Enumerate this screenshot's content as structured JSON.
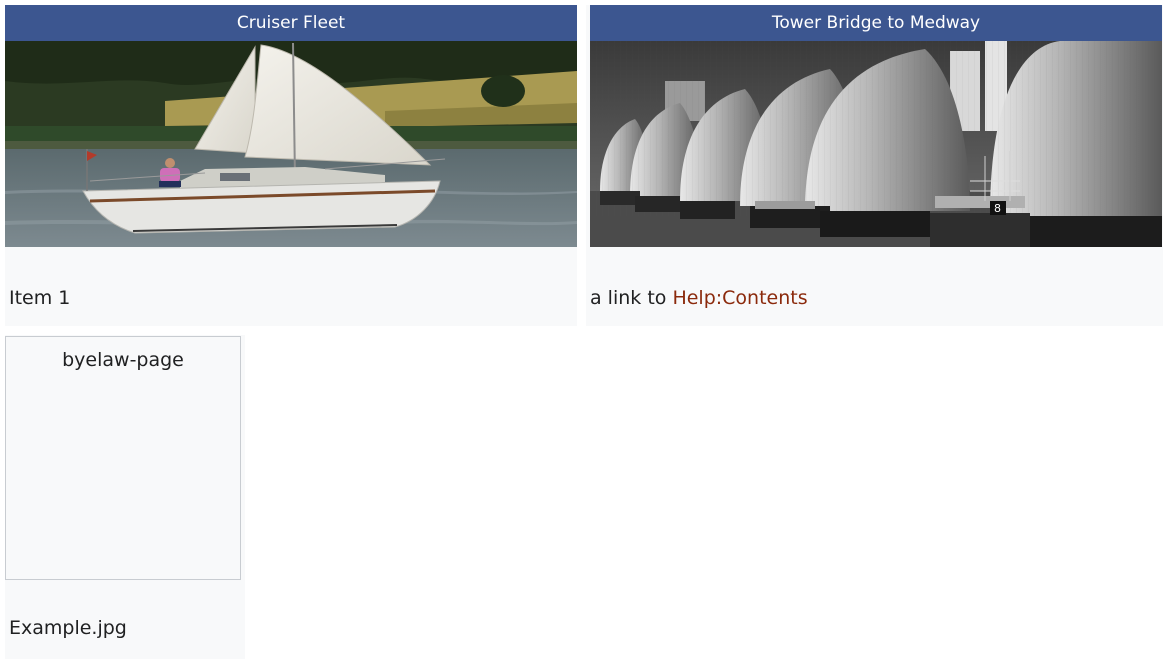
{
  "cards": [
    {
      "header": "Cruiser Fleet",
      "caption": "Item 1"
    },
    {
      "header": "Tower Bridge to Medway",
      "caption_prefix": "a link to ",
      "caption_link": "Help:Contents"
    }
  ],
  "gallery": {
    "placeholder_label": "byelaw-page",
    "caption": "Example.jpg"
  },
  "colors": {
    "header_bg": "#3c5690",
    "link": "#8b2a0c",
    "card_bg": "#f8f9fa"
  }
}
